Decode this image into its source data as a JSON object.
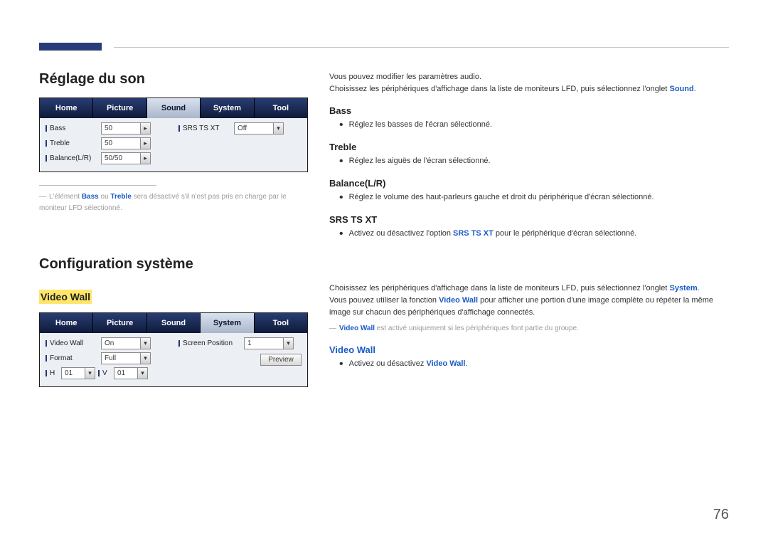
{
  "page_number": "76",
  "left": {
    "h_sound": "Réglage du son",
    "tabs": [
      "Home",
      "Picture",
      "Sound",
      "System",
      "Tool"
    ],
    "active_tab_sound": 2,
    "sound_rows_left": [
      {
        "label": "Bass",
        "value": "50"
      },
      {
        "label": "Treble",
        "value": "50"
      },
      {
        "label": "Balance(L/R)",
        "value": "50/50"
      }
    ],
    "sound_rows_right": [
      {
        "label": "SRS TS XT",
        "value": "Off"
      }
    ],
    "sound_note_pre": "L'élément ",
    "sound_note_b1": "Bass",
    "sound_note_mid": " ou ",
    "sound_note_b2": "Treble",
    "sound_note_post": " sera désactivé s'il n'est pas pris en charge par le moniteur LFD sélectionné.",
    "h_system": "Configuration système",
    "h_videowall": "Video Wall",
    "active_tab_system": 3,
    "system_rows_left": [
      {
        "label": "Video Wall",
        "value": "On"
      },
      {
        "label": "Format",
        "value": "Full"
      }
    ],
    "system_hv": {
      "h_label": "H",
      "h_value": "01",
      "v_label": "V",
      "v_value": "01"
    },
    "system_rows_right": [
      {
        "label": "Screen Position",
        "value": "1"
      }
    ],
    "system_preview_btn": "Preview"
  },
  "right": {
    "intro1": "Vous pouvez modifier les paramètres audio.",
    "intro2_pre": "Choisissez les périphériques d'affichage dans la liste de moniteurs LFD, puis sélectionnez l'onglet ",
    "intro2_b": "Sound",
    "intro2_post": ".",
    "bass_h": "Bass",
    "bass_b": "Réglez les basses de l'écran sélectionné.",
    "treble_h": "Treble",
    "treble_b": "Réglez les aiguës de l'écran sélectionné.",
    "bal_h": "Balance(L/R)",
    "bal_b": "Réglez le volume des haut-parleurs gauche et droit du périphérique d'écran sélectionné.",
    "srs_h": "SRS TS XT",
    "srs_b_pre": "Activez ou désactivez l'option ",
    "srs_b_bold": "SRS TS XT",
    "srs_b_post": " pour le périphérique d'écran sélectionné.",
    "sys_intro_pre": "Choisissez les périphériques d'affichage dans la liste de moniteurs LFD, puis sélectionnez l'onglet ",
    "sys_intro_b": "System",
    "sys_intro_post": ".",
    "sys_p2_pre": "Vous pouvez utiliser la fonction ",
    "sys_p2_b": "Video Wall",
    "sys_p2_post": " pour afficher une portion d'une image complète ou répéter la même image sur chacun des périphériques d'affichage connectés.",
    "sys_note_b": "Video Wall",
    "sys_note_post": " est activé uniquement si les périphériques font partie du groupe.",
    "vw_h": "Video Wall",
    "vw_b_pre": "Activez ou désactivez ",
    "vw_b_bold": "Video Wall",
    "vw_b_post": "."
  }
}
